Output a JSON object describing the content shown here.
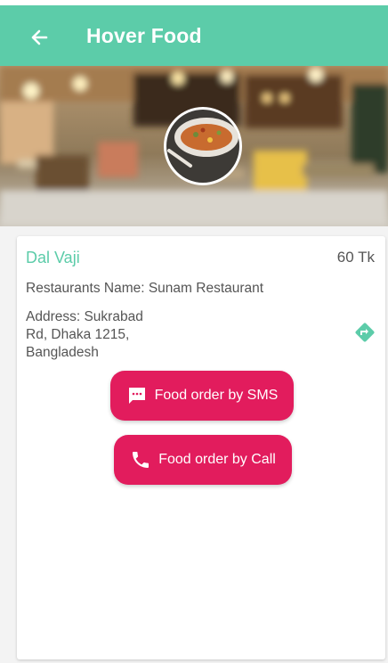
{
  "appbar": {
    "title": "Hover Food",
    "back_icon": "arrow-back-icon"
  },
  "colors": {
    "primary": "#5ccca9",
    "accent": "#e21c5d",
    "text": "#555555"
  },
  "food": {
    "name": "Dal Vaji",
    "price": "60 Tk",
    "restaurant": "Restaurants Name: Sunam Restaurant",
    "address_lines": [
      "Address: Sukrabad",
      "Rd, Dhaka 1215,",
      "Bangladesh"
    ],
    "direction_icon": "directions-icon"
  },
  "actions": {
    "sms_label": "Food order by SMS",
    "sms_icon": "sms-icon",
    "call_label": "Food order by Call",
    "call_icon": "phone-icon"
  }
}
